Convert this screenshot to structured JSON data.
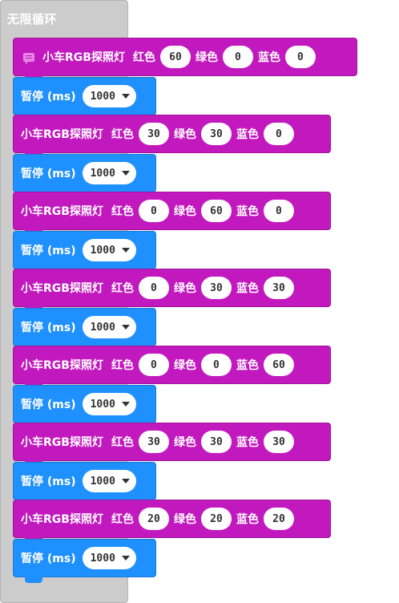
{
  "loop": {
    "title": "无限循环"
  },
  "rgb_label": "小车RGB探照灯",
  "red_label": "红色",
  "green_label": "绿色",
  "blue_label": "蓝色",
  "pause_label": "暂停 (ms)",
  "blocks": [
    {
      "red": "60",
      "green": "0",
      "blue": "0",
      "pause": "1000"
    },
    {
      "red": "30",
      "green": "30",
      "blue": "0",
      "pause": "1000"
    },
    {
      "red": "0",
      "green": "60",
      "blue": "0",
      "pause": "1000"
    },
    {
      "red": "0",
      "green": "30",
      "blue": "30",
      "pause": "1000"
    },
    {
      "red": "0",
      "green": "0",
      "blue": "60",
      "pause": "1000"
    },
    {
      "red": "30",
      "green": "30",
      "blue": "30",
      "pause": "1000"
    },
    {
      "red": "20",
      "green": "20",
      "blue": "20",
      "pause": "1000"
    }
  ],
  "colors": {
    "rgb_block": "#c219bf",
    "pause_block": "#1e90ff",
    "loop_block": "#cccccc"
  },
  "icons": {
    "comment": "comment-icon",
    "dropdown": "caret-down-icon"
  }
}
